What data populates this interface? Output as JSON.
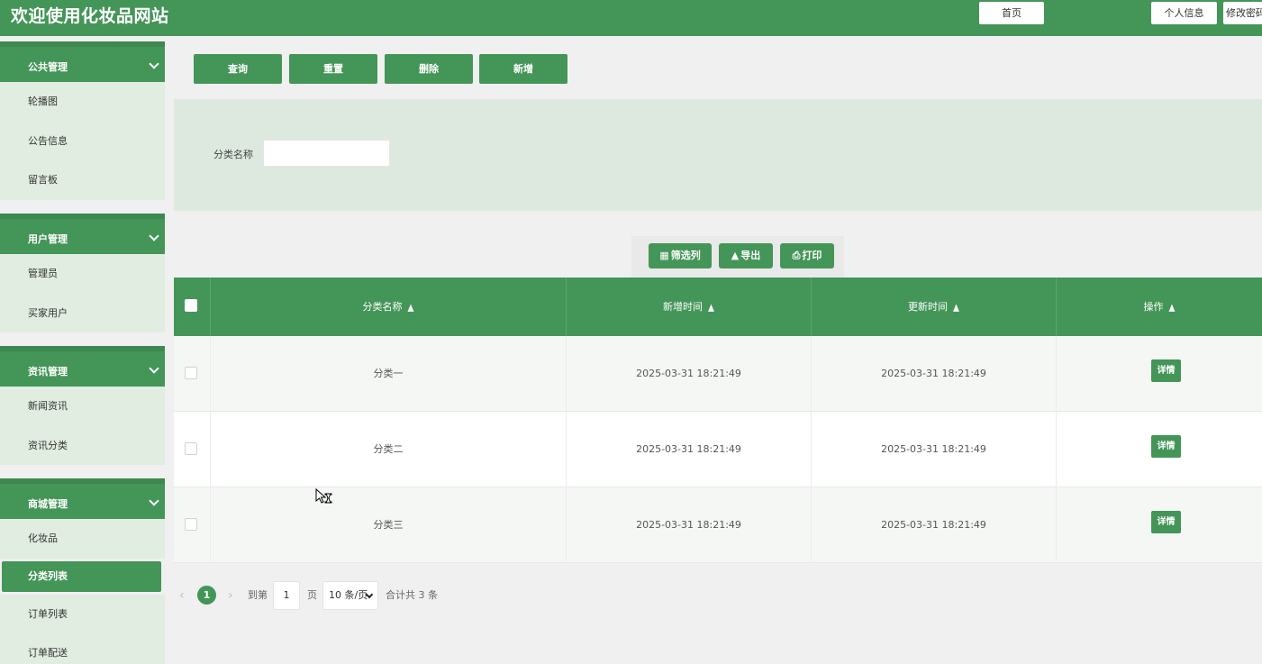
{
  "header": {
    "title": "欢迎使用化妆品网站",
    "home_label": "首页",
    "profile_label": "个人信息",
    "change_pwd_label": "修改密码"
  },
  "sidebar": {
    "groups": [
      {
        "title": "公共管理",
        "items": [
          "轮播图",
          "公告信息",
          "留言板"
        ]
      },
      {
        "title": "用户管理",
        "items": [
          "管理员",
          "买家用户"
        ]
      },
      {
        "title": "资讯管理",
        "items": [
          "新闻资讯",
          "资讯分类"
        ]
      },
      {
        "title": "商城管理",
        "items": [
          "化妆品",
          "分类列表",
          "订单列表",
          "订单配送"
        ]
      }
    ],
    "active_item": "分类列表"
  },
  "toolbar": {
    "query_label": "查询",
    "reset_label": "重置",
    "delete_label": "删除",
    "add_label": "新增"
  },
  "search": {
    "category_label": "分类名称",
    "category_value": ""
  },
  "table_tools": {
    "filter_label": "筛选列",
    "export_label": "导出",
    "print_label": "打印"
  },
  "table": {
    "columns": [
      "分类名称",
      "新增时间",
      "更新时间",
      "操作"
    ],
    "rows": [
      {
        "name": "分类一",
        "created": "2025-03-31 18:21:49",
        "updated": "2025-03-31 18:21:49",
        "action": "详情"
      },
      {
        "name": "分类二",
        "created": "2025-03-31 18:21:49",
        "updated": "2025-03-31 18:21:49",
        "action": "详情"
      },
      {
        "name": "分类三",
        "created": "2025-03-31 18:21:49",
        "updated": "2025-03-31 18:21:49",
        "action": "详情"
      }
    ]
  },
  "pagination": {
    "current_page": "1",
    "goto_label": "到第",
    "page_input": "1",
    "page_unit": "页",
    "page_size": "10 条/页",
    "total_text": "合计共 3 条"
  },
  "icons": {
    "filter": "columns-icon",
    "export": "export-icon",
    "print": "print-icon",
    "sort": "sort-icon",
    "chevron": "chevron-down-icon"
  },
  "colors": {
    "primary": "#449558",
    "panel": "#dde9df",
    "sidebar_item_bg": "#e0ede0"
  }
}
